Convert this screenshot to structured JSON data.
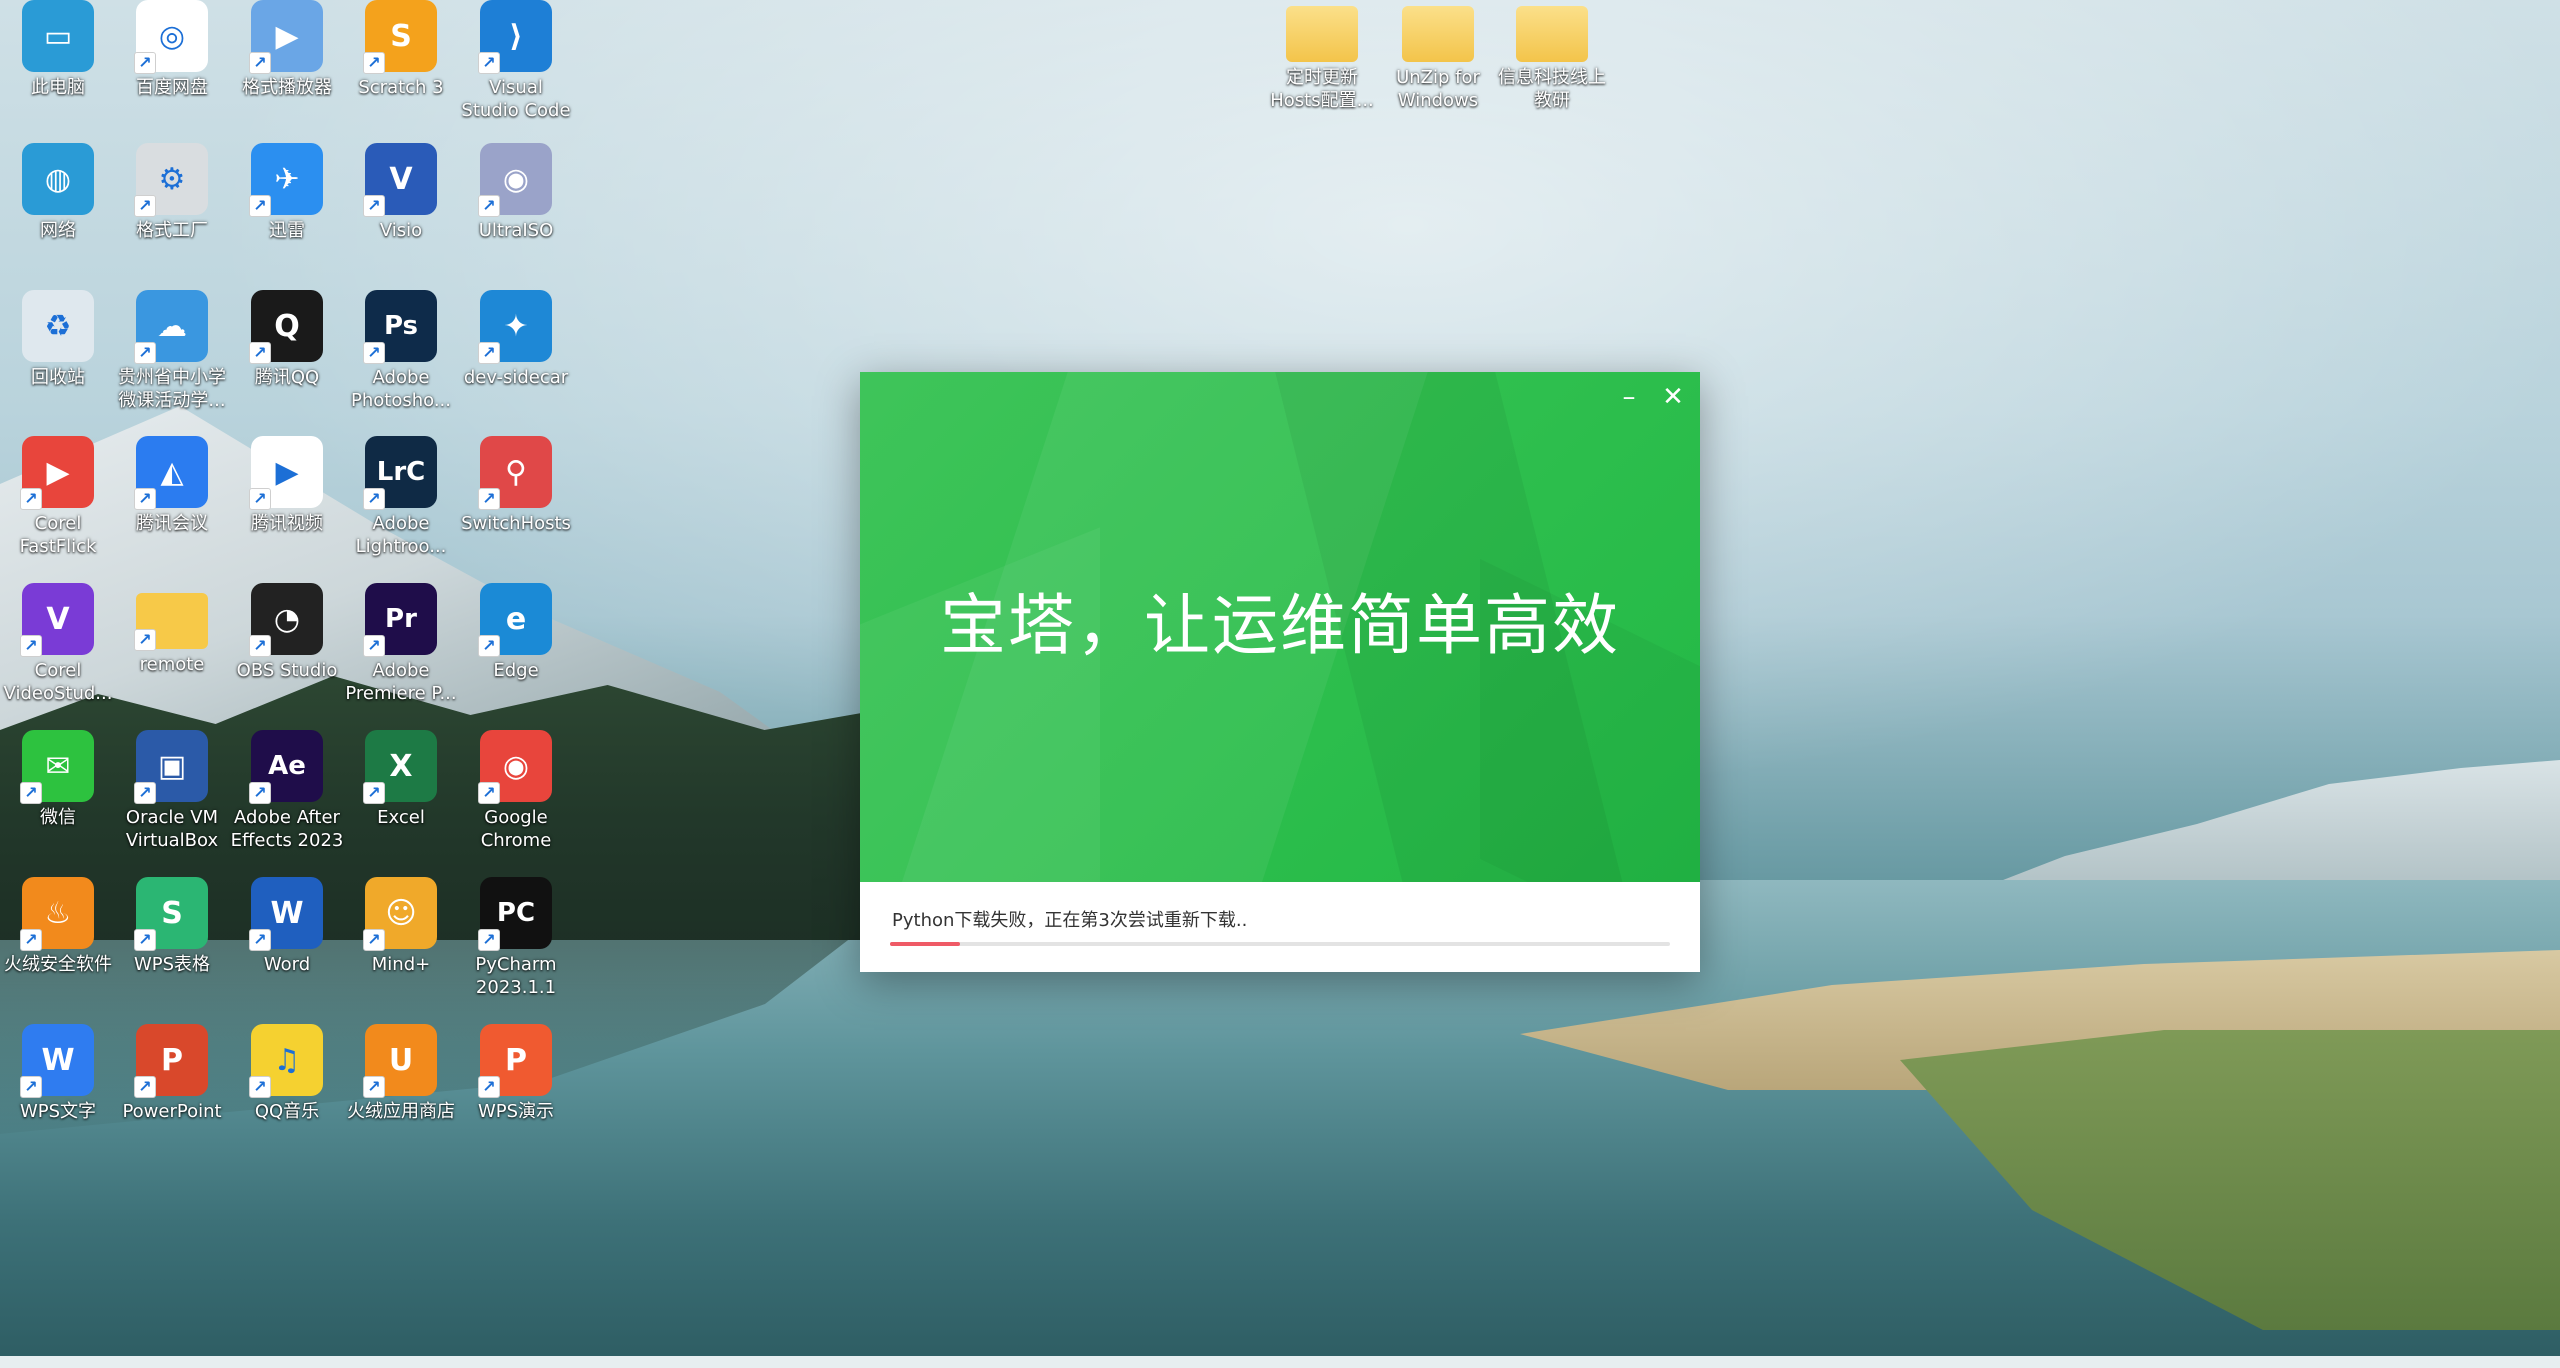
{
  "desktop": {
    "icons": [
      {
        "label": "此电脑",
        "icon": "pc-icon",
        "color": "#2a9bd6",
        "glyph": "▭"
      },
      {
        "label": "百度网盘",
        "icon": "baidu-netdisk-icon",
        "color": "#ffffff",
        "glyph": "◎"
      },
      {
        "label": "格式播放器",
        "icon": "video-player-icon",
        "color": "#6aa6e6",
        "glyph": "▶"
      },
      {
        "label": "Scratch 3",
        "icon": "scratch-icon",
        "color": "#f4a21c",
        "glyph": "S"
      },
      {
        "label": "Visual Studio Code",
        "icon": "vscode-icon",
        "color": "#1e7fd6",
        "glyph": "⟩"
      },
      {
        "label": "网络",
        "icon": "network-icon",
        "color": "#2a9bd6",
        "glyph": "◍"
      },
      {
        "label": "格式工厂",
        "icon": "format-factory-icon",
        "color": "#d9dde0",
        "glyph": "⚙"
      },
      {
        "label": "迅雷",
        "icon": "xunlei-icon",
        "color": "#2b8ff0",
        "glyph": "✈"
      },
      {
        "label": "Visio",
        "icon": "visio-icon",
        "color": "#2a5bb8",
        "glyph": "V"
      },
      {
        "label": "UltraISO",
        "icon": "ultraiso-icon",
        "color": "#9aa3c9",
        "glyph": "◉"
      },
      {
        "label": "回收站",
        "icon": "recycle-bin-icon",
        "color": "#dfe8ee",
        "glyph": "♻"
      },
      {
        "label": "贵州省中小学微课活动学...",
        "icon": "micro-course-icon",
        "color": "#3a97e0",
        "glyph": "☁"
      },
      {
        "label": "腾讯QQ",
        "icon": "qq-icon",
        "color": "#1a1a1a",
        "glyph": "Q"
      },
      {
        "label": "Adobe Photosho...",
        "icon": "photoshop-icon",
        "color": "#0e2b4a",
        "glyph": "Ps"
      },
      {
        "label": "dev-sidecar",
        "icon": "dev-sidecar-icon",
        "color": "#1e88d6",
        "glyph": "✦"
      },
      {
        "label": "Corel FastFlick",
        "icon": "corel-fastflick-icon",
        "color": "#e8453c",
        "glyph": "▶"
      },
      {
        "label": "腾讯会议",
        "icon": "tencent-meeting-icon",
        "color": "#2b7cf0",
        "glyph": "◭"
      },
      {
        "label": "腾讯视频",
        "icon": "tencent-video-icon",
        "color": "#ffffff",
        "glyph": "▶"
      },
      {
        "label": "Adobe Lightroo...",
        "icon": "lightroom-icon",
        "color": "#0f2a45",
        "glyph": "LrC"
      },
      {
        "label": "SwitchHosts",
        "icon": "switchhosts-icon",
        "color": "#e04848",
        "glyph": "⚲"
      },
      {
        "label": "Corel VideoStud...",
        "icon": "corel-videostudio-icon",
        "color": "#7a3bd6",
        "glyph": "V"
      },
      {
        "label": "remote",
        "icon": "folder-icon",
        "color": "#f7c948",
        "glyph": ""
      },
      {
        "label": "OBS Studio",
        "icon": "obs-icon",
        "color": "#222222",
        "glyph": "◔"
      },
      {
        "label": "Adobe Premiere P...",
        "icon": "premiere-icon",
        "color": "#1f0d4a",
        "glyph": "Pr"
      },
      {
        "label": "Edge",
        "icon": "edge-icon",
        "color": "#1b8ad6",
        "glyph": "e"
      },
      {
        "label": "微信",
        "icon": "wechat-icon",
        "color": "#2dc23f",
        "glyph": "✉"
      },
      {
        "label": "Oracle VM VirtualBox",
        "icon": "virtualbox-icon",
        "color": "#2b5aa8",
        "glyph": "▣"
      },
      {
        "label": "Adobe After Effects 2023",
        "icon": "after-effects-icon",
        "color": "#1f0d4a",
        "glyph": "Ae"
      },
      {
        "label": "Excel",
        "icon": "excel-icon",
        "color": "#1d7a45",
        "glyph": "X"
      },
      {
        "label": "Google Chrome",
        "icon": "chrome-icon",
        "color": "#e8453c",
        "glyph": "◉"
      },
      {
        "label": "火绒安全软件",
        "icon": "huorong-icon",
        "color": "#f28a1c",
        "glyph": "♨"
      },
      {
        "label": "WPS表格",
        "icon": "wps-sheet-icon",
        "color": "#2bb673",
        "glyph": "S"
      },
      {
        "label": "Word",
        "icon": "word-icon",
        "color": "#1f5fbf",
        "glyph": "W"
      },
      {
        "label": "Mind+",
        "icon": "mindplus-icon",
        "color": "#f0a92a",
        "glyph": "☺"
      },
      {
        "label": "PyCharm 2023.1.1",
        "icon": "pycharm-icon",
        "color": "#111111",
        "glyph": "PC"
      },
      {
        "label": "WPS文字",
        "icon": "wps-writer-icon",
        "color": "#2f7cf0",
        "glyph": "W"
      },
      {
        "label": "PowerPoint",
        "icon": "powerpoint-icon",
        "color": "#d9482b",
        "glyph": "P"
      },
      {
        "label": "QQ音乐",
        "icon": "qq-music-icon",
        "color": "#f5d130",
        "glyph": "♫"
      },
      {
        "label": "火绒应用商店",
        "icon": "huorong-store-icon",
        "color": "#f28a1c",
        "glyph": "U"
      },
      {
        "label": "WPS演示",
        "icon": "wps-presentation-icon",
        "color": "#f05a30",
        "glyph": "P"
      }
    ],
    "folders": [
      {
        "label": "定时更新Hosts配置...",
        "icon": "folder-icon"
      },
      {
        "label": "UnZip for Windows",
        "icon": "folder-icon"
      },
      {
        "label": "信息科技线上教研",
        "icon": "folder-icon"
      }
    ]
  },
  "installer": {
    "headline": "宝塔，让运维简单高效",
    "minimize": "–",
    "close": "✕",
    "status": "Python下载失败，正在第3次尝试重新下载..",
    "progress": 0.09,
    "accent": "#22b845",
    "progress_color": "#ef5a66"
  }
}
